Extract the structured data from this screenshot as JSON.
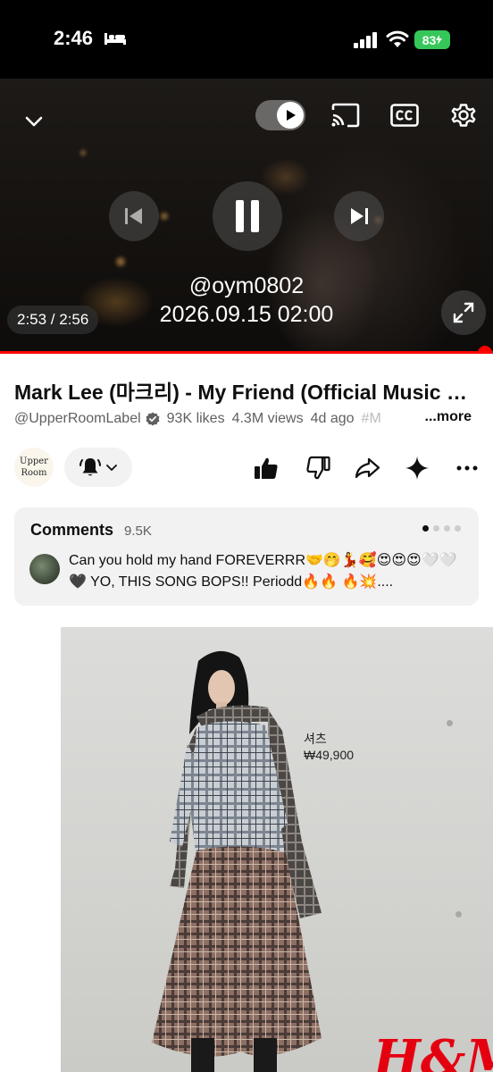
{
  "status_bar": {
    "time": "2:46",
    "battery": "83"
  },
  "player": {
    "overlay_handle": "@oym0802",
    "overlay_date": "2026.09.15 02:00",
    "time_display": "2:53 / 2:56",
    "progress_fraction": 0.983,
    "accent_color": "#ff0000"
  },
  "video": {
    "title": "Mark Lee (마크리) - My Friend (Official Music Video)",
    "channel": "@UpperRoomLabel",
    "likes": "93K likes",
    "views": "4.3M views",
    "age": "4d ago",
    "hashtag": "#M",
    "more_label": "...more"
  },
  "channel_avatar": {
    "line1": "Upper",
    "line2": "Room"
  },
  "comments": {
    "title": "Comments",
    "count": "9.5K",
    "top_comment": "Can you hold my hand FOREVERRR🤝🤭💃🥰😍😍😍🤍🤍🖤 YO, THIS SONG BOPS!! Periodd🔥🔥 🔥💥...."
  },
  "ad": {
    "price_label": "셔츠",
    "price": "₩49,900",
    "brand": "H&M"
  },
  "icons": {
    "collapse": "chevron-down-icon",
    "autoplay": "autoplay-toggle",
    "cast": "cast-icon",
    "captions": "cc-icon",
    "settings": "gear-icon",
    "prev": "skip-previous-icon",
    "pause": "pause-icon",
    "next": "skip-next-icon",
    "fullscreen": "fullscreen-icon",
    "bell": "bell-icon",
    "like": "thumbs-up-icon",
    "dislike": "thumbs-down-icon",
    "share": "share-icon",
    "ask": "sparkle-icon",
    "more": "more-icon"
  }
}
